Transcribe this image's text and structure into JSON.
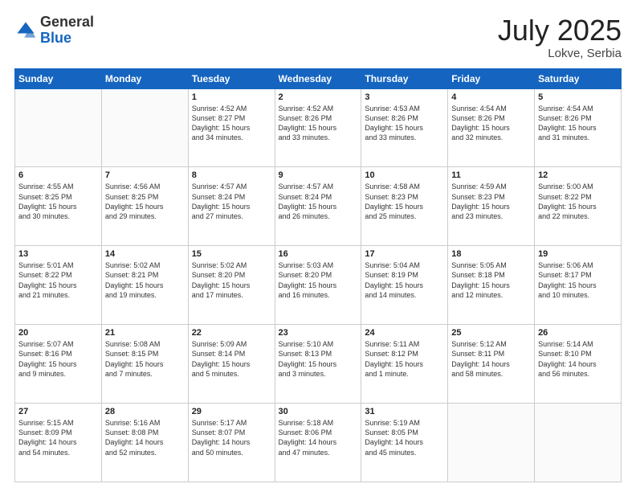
{
  "header": {
    "logo_general": "General",
    "logo_blue": "Blue",
    "month_year": "July 2025",
    "location": "Lokve, Serbia"
  },
  "weekdays": [
    "Sunday",
    "Monday",
    "Tuesday",
    "Wednesday",
    "Thursday",
    "Friday",
    "Saturday"
  ],
  "rows": [
    [
      {
        "day": "",
        "text": "",
        "empty": true
      },
      {
        "day": "",
        "text": "",
        "empty": true
      },
      {
        "day": "1",
        "text": "Sunrise: 4:52 AM\nSunset: 8:27 PM\nDaylight: 15 hours\nand 34 minutes."
      },
      {
        "day": "2",
        "text": "Sunrise: 4:52 AM\nSunset: 8:26 PM\nDaylight: 15 hours\nand 33 minutes."
      },
      {
        "day": "3",
        "text": "Sunrise: 4:53 AM\nSunset: 8:26 PM\nDaylight: 15 hours\nand 33 minutes."
      },
      {
        "day": "4",
        "text": "Sunrise: 4:54 AM\nSunset: 8:26 PM\nDaylight: 15 hours\nand 32 minutes."
      },
      {
        "day": "5",
        "text": "Sunrise: 4:54 AM\nSunset: 8:26 PM\nDaylight: 15 hours\nand 31 minutes."
      }
    ],
    [
      {
        "day": "6",
        "text": "Sunrise: 4:55 AM\nSunset: 8:25 PM\nDaylight: 15 hours\nand 30 minutes."
      },
      {
        "day": "7",
        "text": "Sunrise: 4:56 AM\nSunset: 8:25 PM\nDaylight: 15 hours\nand 29 minutes."
      },
      {
        "day": "8",
        "text": "Sunrise: 4:57 AM\nSunset: 8:24 PM\nDaylight: 15 hours\nand 27 minutes."
      },
      {
        "day": "9",
        "text": "Sunrise: 4:57 AM\nSunset: 8:24 PM\nDaylight: 15 hours\nand 26 minutes."
      },
      {
        "day": "10",
        "text": "Sunrise: 4:58 AM\nSunset: 8:23 PM\nDaylight: 15 hours\nand 25 minutes."
      },
      {
        "day": "11",
        "text": "Sunrise: 4:59 AM\nSunset: 8:23 PM\nDaylight: 15 hours\nand 23 minutes."
      },
      {
        "day": "12",
        "text": "Sunrise: 5:00 AM\nSunset: 8:22 PM\nDaylight: 15 hours\nand 22 minutes."
      }
    ],
    [
      {
        "day": "13",
        "text": "Sunrise: 5:01 AM\nSunset: 8:22 PM\nDaylight: 15 hours\nand 21 minutes."
      },
      {
        "day": "14",
        "text": "Sunrise: 5:02 AM\nSunset: 8:21 PM\nDaylight: 15 hours\nand 19 minutes."
      },
      {
        "day": "15",
        "text": "Sunrise: 5:02 AM\nSunset: 8:20 PM\nDaylight: 15 hours\nand 17 minutes."
      },
      {
        "day": "16",
        "text": "Sunrise: 5:03 AM\nSunset: 8:20 PM\nDaylight: 15 hours\nand 16 minutes."
      },
      {
        "day": "17",
        "text": "Sunrise: 5:04 AM\nSunset: 8:19 PM\nDaylight: 15 hours\nand 14 minutes."
      },
      {
        "day": "18",
        "text": "Sunrise: 5:05 AM\nSunset: 8:18 PM\nDaylight: 15 hours\nand 12 minutes."
      },
      {
        "day": "19",
        "text": "Sunrise: 5:06 AM\nSunset: 8:17 PM\nDaylight: 15 hours\nand 10 minutes."
      }
    ],
    [
      {
        "day": "20",
        "text": "Sunrise: 5:07 AM\nSunset: 8:16 PM\nDaylight: 15 hours\nand 9 minutes."
      },
      {
        "day": "21",
        "text": "Sunrise: 5:08 AM\nSunset: 8:15 PM\nDaylight: 15 hours\nand 7 minutes."
      },
      {
        "day": "22",
        "text": "Sunrise: 5:09 AM\nSunset: 8:14 PM\nDaylight: 15 hours\nand 5 minutes."
      },
      {
        "day": "23",
        "text": "Sunrise: 5:10 AM\nSunset: 8:13 PM\nDaylight: 15 hours\nand 3 minutes."
      },
      {
        "day": "24",
        "text": "Sunrise: 5:11 AM\nSunset: 8:12 PM\nDaylight: 15 hours\nand 1 minute."
      },
      {
        "day": "25",
        "text": "Sunrise: 5:12 AM\nSunset: 8:11 PM\nDaylight: 14 hours\nand 58 minutes."
      },
      {
        "day": "26",
        "text": "Sunrise: 5:14 AM\nSunset: 8:10 PM\nDaylight: 14 hours\nand 56 minutes."
      }
    ],
    [
      {
        "day": "27",
        "text": "Sunrise: 5:15 AM\nSunset: 8:09 PM\nDaylight: 14 hours\nand 54 minutes."
      },
      {
        "day": "28",
        "text": "Sunrise: 5:16 AM\nSunset: 8:08 PM\nDaylight: 14 hours\nand 52 minutes."
      },
      {
        "day": "29",
        "text": "Sunrise: 5:17 AM\nSunset: 8:07 PM\nDaylight: 14 hours\nand 50 minutes."
      },
      {
        "day": "30",
        "text": "Sunrise: 5:18 AM\nSunset: 8:06 PM\nDaylight: 14 hours\nand 47 minutes."
      },
      {
        "day": "31",
        "text": "Sunrise: 5:19 AM\nSunset: 8:05 PM\nDaylight: 14 hours\nand 45 minutes."
      },
      {
        "day": "",
        "text": "",
        "empty": true
      },
      {
        "day": "",
        "text": "",
        "empty": true
      }
    ]
  ]
}
